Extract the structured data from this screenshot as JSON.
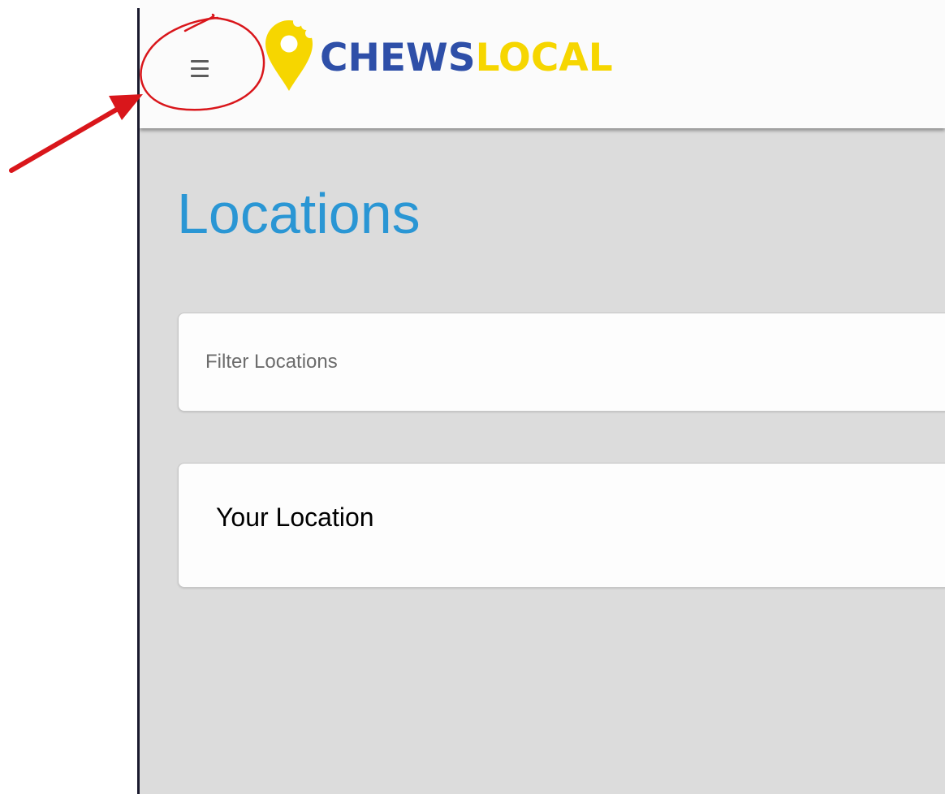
{
  "header": {
    "menu_icon": "hamburger-menu-icon",
    "logo": {
      "icon": "map-pin-bite-icon",
      "text_part1": "CHEWS",
      "text_part2": "LOCAL",
      "colors": {
        "brand_blue": "#2e4fa8",
        "brand_yellow": "#f6d600"
      }
    }
  },
  "main": {
    "title": "Locations",
    "title_color": "#2a96d4",
    "filter": {
      "value": "",
      "placeholder": "Filter Locations"
    },
    "locations": [
      {
        "label": "Your Location"
      }
    ]
  },
  "annotation": {
    "color": "#d9161b",
    "shapes": [
      "circle-highlight",
      "arrow-pointer"
    ]
  }
}
